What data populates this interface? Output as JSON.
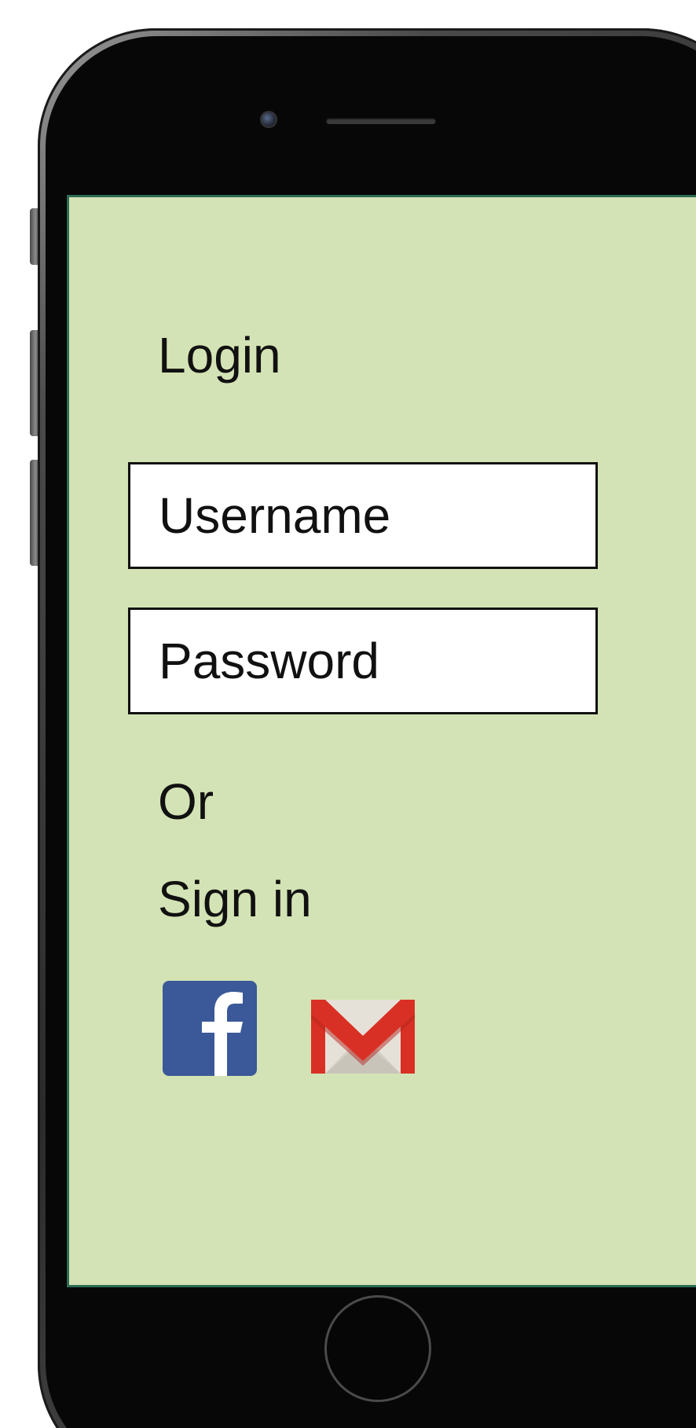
{
  "screen": {
    "title": "Login",
    "username": {
      "placeholder": "Username",
      "value": ""
    },
    "password": {
      "placeholder": "Password",
      "value": ""
    },
    "or_text": "Or",
    "sign_in_text": "Sign in",
    "social": [
      {
        "icon": "facebook-icon",
        "color": "#3b5998"
      },
      {
        "icon": "gmail-icon",
        "color": "#d93025"
      }
    ]
  },
  "colors": {
    "screen_background": "#d4e3b5",
    "screen_border": "#2d6b55",
    "phone_body": "#070707",
    "text": "#111111"
  }
}
